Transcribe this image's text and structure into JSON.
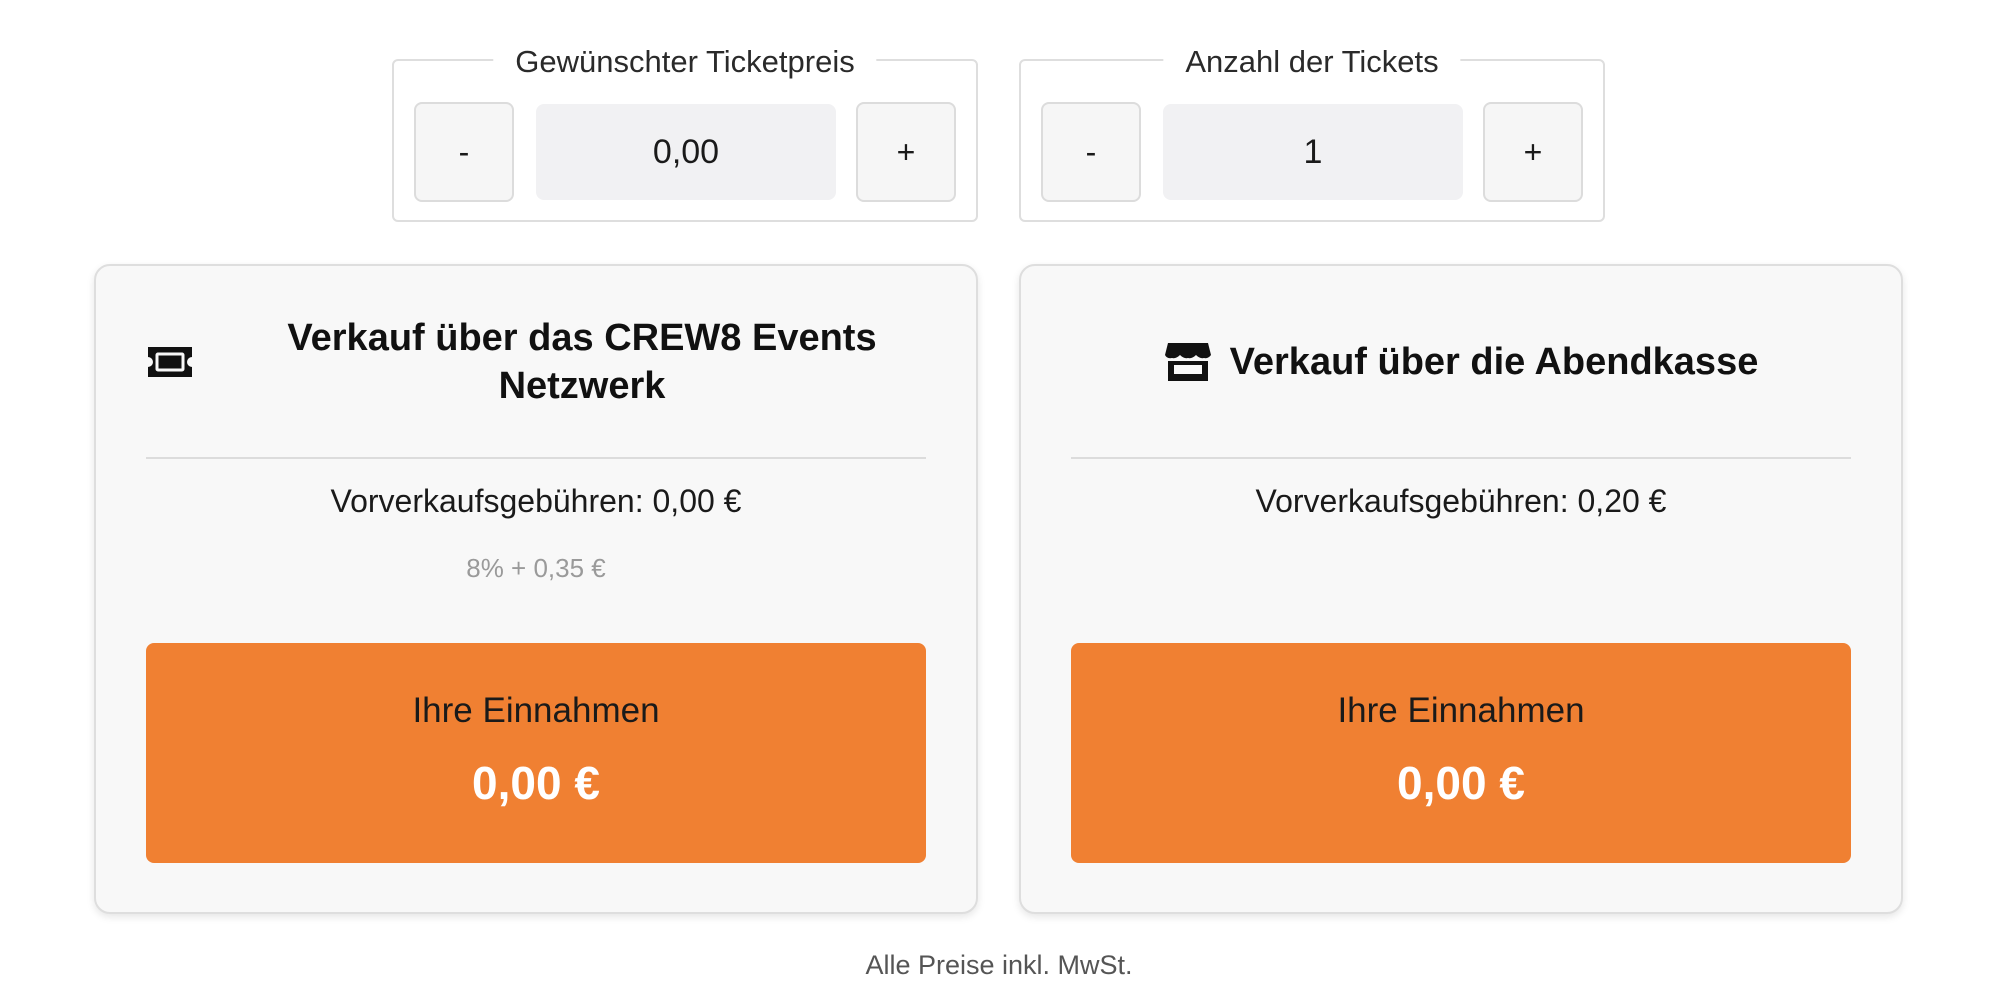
{
  "colors": {
    "accent": "#f08032",
    "card_background": "#f8f8f8",
    "muted_text": "#9a9a9a"
  },
  "price_stepper": {
    "legend": "Gewünschter Ticketpreis",
    "minus_label": "-",
    "value": "0,00",
    "plus_label": "+"
  },
  "count_stepper": {
    "legend": "Anzahl der Tickets",
    "minus_label": "-",
    "value": "1",
    "plus_label": "+"
  },
  "network_card": {
    "icon": "ticket-icon",
    "title": "Verkauf über das CREW8 Events Netzwerk",
    "fee_text": "Vorverkaufsgebühren: 0,00 €",
    "fee_formula": "8% + 0,35 €",
    "income_label": "Ihre Einnahmen",
    "income_amount": "0,00 €"
  },
  "boxoffice_card": {
    "icon": "store-icon",
    "title": "Verkauf über die Abendkasse",
    "fee_text": "Vorverkaufsgebühren: 0,20 €",
    "income_label": "Ihre Einnahmen",
    "income_amount": "0,00 €"
  },
  "footnote": "Alle Preise inkl. MwSt."
}
